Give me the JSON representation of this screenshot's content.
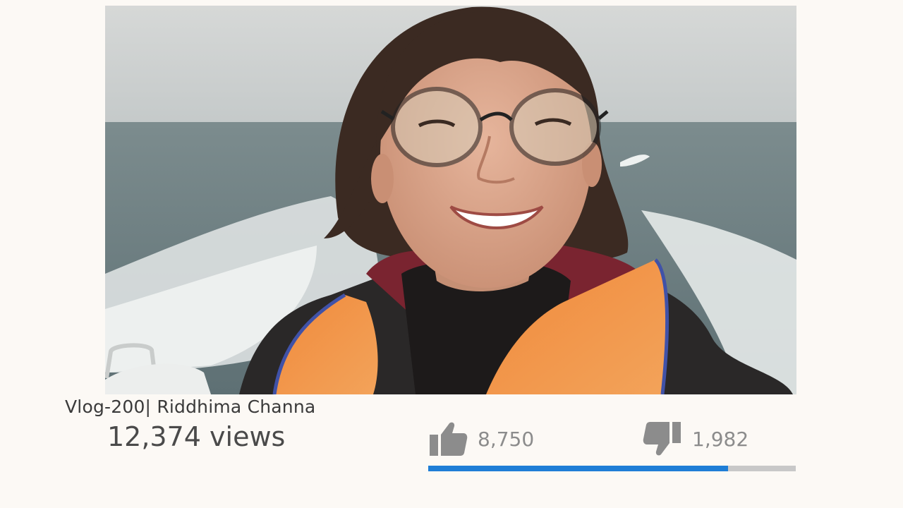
{
  "video": {
    "title": "Vlog-200| Riddhima Channa",
    "views": "12,374 views"
  },
  "rating": {
    "likes": "8,750",
    "dislikes": "1,982",
    "like_fraction": 0.815
  },
  "icons": {
    "like": "thumbs-up-icon",
    "dislike": "thumbs-down-icon"
  },
  "colors": {
    "background": "#fcf9f5",
    "like_bar": "#1f7ed6",
    "bar_track": "#c8c8c8",
    "icon": "#8c8c8c"
  }
}
